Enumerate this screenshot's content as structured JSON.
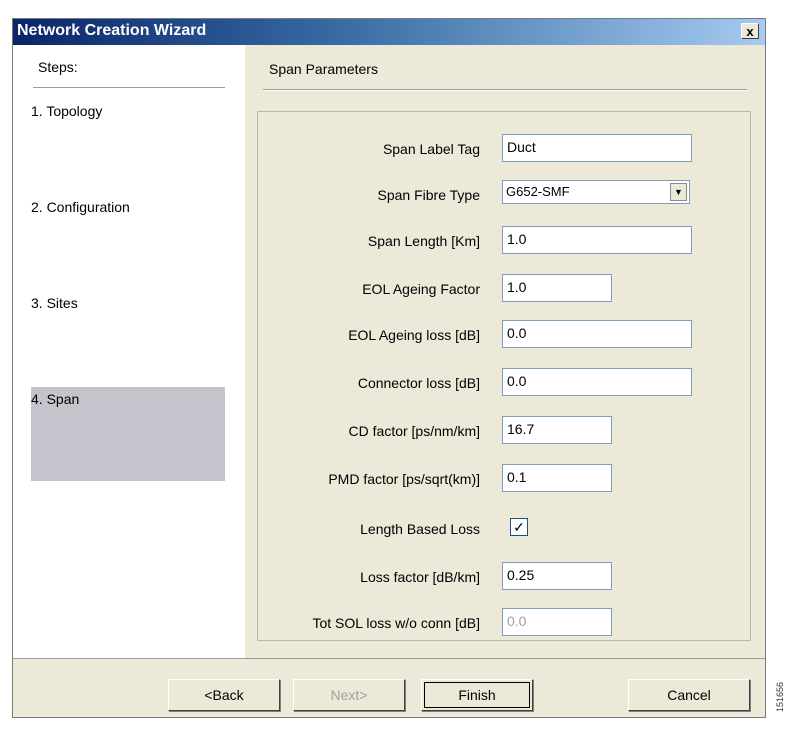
{
  "window": {
    "title": "Network Creation Wizard",
    "close_label": "x"
  },
  "sidebar": {
    "header": "Steps:",
    "steps": [
      {
        "label": "1. Topology",
        "active": false
      },
      {
        "label": "2. Configuration",
        "active": false
      },
      {
        "label": "3. Sites",
        "active": false
      },
      {
        "label": "4. Span",
        "active": true
      }
    ]
  },
  "main": {
    "section_title": "Span Parameters",
    "fields": {
      "span_label_tag": {
        "label": "Span Label Tag",
        "value": "Duct"
      },
      "span_fibre_type": {
        "label": "Span Fibre Type",
        "value": "G652-SMF"
      },
      "span_length": {
        "label": "Span Length [Km]",
        "value": "1.0"
      },
      "eol_ageing_factor": {
        "label": "EOL Ageing Factor",
        "value": "1.0"
      },
      "eol_ageing_loss": {
        "label": "EOL Ageing loss [dB]",
        "value": "0.0"
      },
      "connector_loss": {
        "label": "Connector loss [dB]",
        "value": "0.0"
      },
      "cd_factor": {
        "label": "CD factor [ps/nm/km]",
        "value": "16.7"
      },
      "pmd_factor": {
        "label": "PMD factor [ps/sqrt(km)]",
        "value": "0.1"
      },
      "length_based_loss": {
        "label": "Length Based Loss",
        "checked": true,
        "mark": "✓"
      },
      "loss_factor": {
        "label": "Loss factor [dB/km]",
        "value": "0.25"
      },
      "tot_sol_loss": {
        "label": "Tot SOL loss w/o conn [dB]",
        "value": "0.0"
      }
    }
  },
  "footer": {
    "back_label": "<Back",
    "next_label": "Next>",
    "finish_label": "Finish",
    "cancel_label": "Cancel"
  },
  "side_id": "151656"
}
